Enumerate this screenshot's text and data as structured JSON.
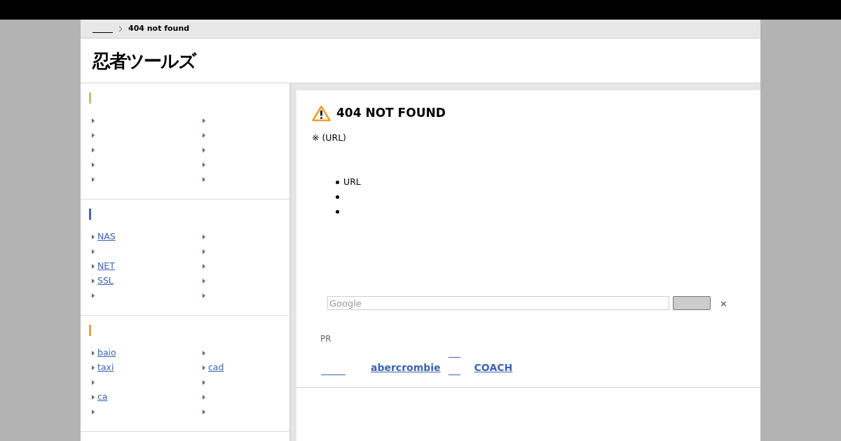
{
  "breadcrumb": {
    "current": "404 not found"
  },
  "logo": {
    "text": "忍者ツールズ"
  },
  "sidebar": {
    "sections": [
      {
        "color": "#a5d16a",
        "items": [
          {
            "kind": "blank"
          },
          {
            "kind": "blank"
          },
          {
            "kind": "blank"
          },
          {
            "kind": "blank"
          },
          {
            "kind": "blank"
          },
          {
            "kind": "blank"
          },
          {
            "kind": "blank"
          },
          {
            "kind": "blank"
          },
          {
            "kind": "blank"
          },
          {
            "kind": "blank"
          }
        ]
      },
      {
        "color": "#4a5fc1",
        "items": [
          {
            "kind": "link",
            "label": "NAS"
          },
          {
            "kind": "blank"
          },
          {
            "kind": "blank"
          },
          {
            "kind": "blank"
          },
          {
            "kind": "link",
            "label": "NET"
          },
          {
            "kind": "blank"
          },
          {
            "kind": "link",
            "label": "SSL"
          },
          {
            "kind": "blank"
          },
          {
            "kind": "blank"
          },
          {
            "kind": "blank"
          }
        ]
      },
      {
        "color": "#e8a33a",
        "items": [
          {
            "kind": "link",
            "label": "baio"
          },
          {
            "kind": "blank"
          },
          {
            "kind": "link",
            "label": "taxi"
          },
          {
            "kind": "link",
            "label": "cad"
          },
          {
            "kind": "blank"
          },
          {
            "kind": "blank"
          },
          {
            "kind": "link",
            "label": "ca"
          },
          {
            "kind": "blank"
          },
          {
            "kind": "blank"
          },
          {
            "kind": "blank"
          }
        ]
      }
    ]
  },
  "main": {
    "title": "404 NOT FOUND",
    "note": "※ (URL)",
    "bullets": [
      {
        "kind": "text",
        "text": "URL"
      },
      {
        "kind": "blank"
      },
      {
        "kind": "blank"
      }
    ],
    "search": {
      "placeholder": "Google",
      "close": "×"
    },
    "pr": {
      "label": "PR",
      "links": [
        {
          "kind": "empty"
        },
        {
          "kind": "text",
          "text": "abercrombie"
        },
        {
          "kind": "stack"
        },
        {
          "kind": "text",
          "text": "COACH"
        }
      ]
    }
  }
}
